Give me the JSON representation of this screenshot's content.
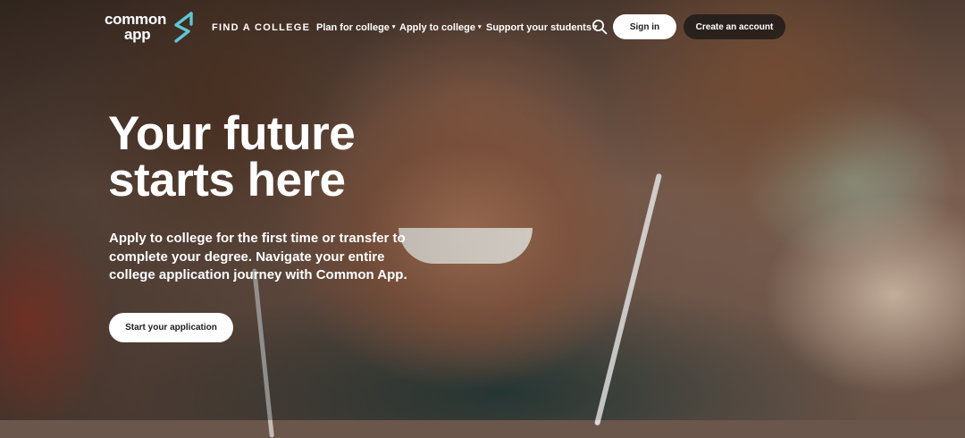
{
  "header": {
    "logo": {
      "line1": "common",
      "line2": "app",
      "icon": "common-app-logo-mark"
    },
    "nav": {
      "find_college": "FIND A COLLEGE",
      "plan": "Plan for college",
      "apply": "Apply to college",
      "support": "Support your students",
      "caret": "▾"
    },
    "search_icon": "search-icon",
    "signin_label": "Sign in",
    "create_account_label": "Create an account"
  },
  "hero": {
    "title_line1": "Your future",
    "title_line2": "starts here",
    "subtitle": "Apply to college for the first time or transfer to complete your degree. Navigate your entire college application journey with Common App.",
    "cta_label": "Start your application"
  },
  "colors": {
    "logo_accent": "#5fc6d6",
    "button_light": "#ffffff",
    "button_dark": "#1a1a1a",
    "text": "#ffffff"
  }
}
